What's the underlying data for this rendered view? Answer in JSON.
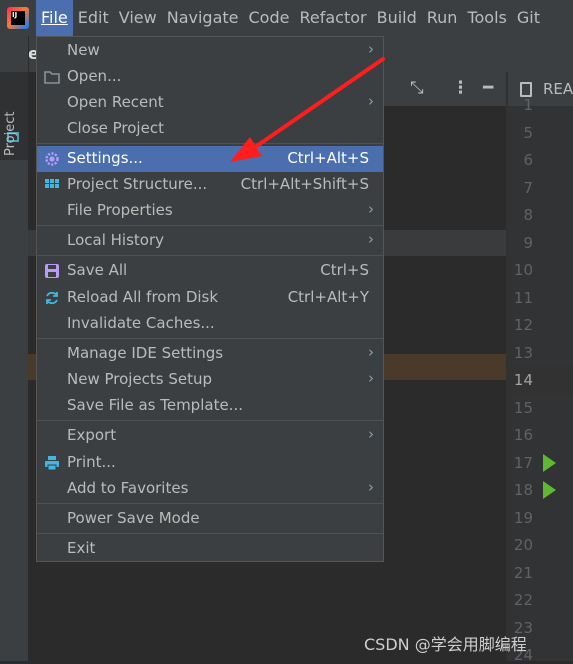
{
  "menubar": {
    "items": [
      {
        "label": "File"
      },
      {
        "label": "Edit"
      },
      {
        "label": "View"
      },
      {
        "label": "Navigate"
      },
      {
        "label": "Code"
      },
      {
        "label": "Refactor"
      },
      {
        "label": "Build"
      },
      {
        "label": "Run"
      },
      {
        "label": "Tools"
      },
      {
        "label": "Git"
      }
    ],
    "logo_text": "IJ"
  },
  "project_title": "jse",
  "sidebar": {
    "project_label": "Project"
  },
  "readme_tab": "REA",
  "line_numbers": [
    "1",
    "5",
    "6",
    "7",
    "8",
    "9",
    "10",
    "11",
    "12",
    "13",
    "14",
    "15",
    "16",
    "17",
    "18",
    "19",
    "20",
    "21",
    "22",
    "23",
    "24"
  ],
  "current_line": "14",
  "file_menu": {
    "new": "New",
    "open": "Open...",
    "open_recent": "Open Recent",
    "close_project": "Close Project",
    "settings": "Settings...",
    "settings_shortcut": "Ctrl+Alt+S",
    "project_structure": "Project Structure...",
    "project_structure_shortcut": "Ctrl+Alt+Shift+S",
    "file_properties": "File Properties",
    "local_history": "Local History",
    "save_all": "Save All",
    "save_all_shortcut": "Ctrl+S",
    "reload": "Reload All from Disk",
    "reload_shortcut": "Ctrl+Alt+Y",
    "invalidate": "Invalidate Caches...",
    "manage_ide": "Manage IDE Settings",
    "new_projects_setup": "New Projects Setup",
    "save_template": "Save File as Template...",
    "export": "Export",
    "print": "Print...",
    "add_favorites": "Add to Favorites",
    "power_save": "Power Save Mode",
    "exit": "Exit"
  },
  "watermark": "CSDN @学会用脚编程",
  "colors": {
    "selection": "#4b6eaf",
    "menu_bg": "#3c3f41",
    "annotation_arrow": "#ff1e1e",
    "run_icon": "#5fb832"
  }
}
